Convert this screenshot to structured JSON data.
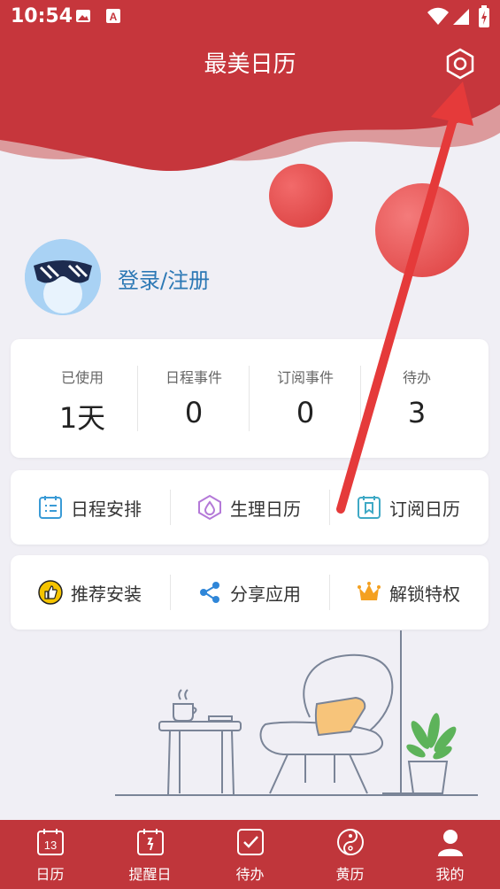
{
  "status_bar": {
    "time": "10:54"
  },
  "header": {
    "title": "最美日历"
  },
  "profile": {
    "login_text": "登录/注册"
  },
  "stats": [
    {
      "label": "已使用",
      "value": "1天"
    },
    {
      "label": "日程事件",
      "value": "0"
    },
    {
      "label": "订阅事件",
      "value": "0"
    },
    {
      "label": "待办",
      "value": "3"
    }
  ],
  "features_row1": [
    {
      "label": "日程安排",
      "icon": "schedule-icon",
      "color": "#3a9bd6"
    },
    {
      "label": "生理日历",
      "icon": "drop-icon",
      "color": "#b479d8"
    },
    {
      "label": "订阅日历",
      "icon": "bookmark-calendar-icon",
      "color": "#3fa9c5"
    }
  ],
  "features_row2": [
    {
      "label": "推荐安装",
      "icon": "thumbs-up-icon",
      "color": "#f5c400"
    },
    {
      "label": "分享应用",
      "icon": "share-icon",
      "color": "#2f86d8"
    },
    {
      "label": "解锁特权",
      "icon": "crown-icon",
      "color": "#f4a020"
    }
  ],
  "tabs": [
    {
      "label": "日历",
      "icon": "calendar-icon"
    },
    {
      "label": "提醒日",
      "icon": "reminder-icon"
    },
    {
      "label": "待办",
      "icon": "checkbox-icon"
    },
    {
      "label": "黄历",
      "icon": "yin-yang-icon"
    },
    {
      "label": "我的",
      "icon": "user-icon"
    }
  ],
  "colors": {
    "brand": "#c0363b",
    "accent_link": "#2c78b5",
    "arrow": "#e53a3a"
  }
}
